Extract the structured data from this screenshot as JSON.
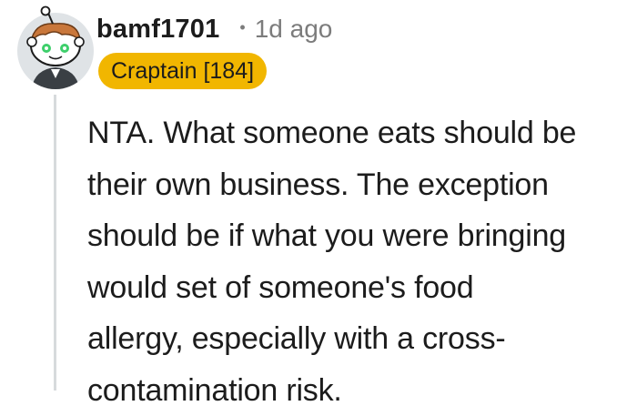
{
  "comment": {
    "username": "bamf1701",
    "separator": "•",
    "time_ago": "1d ago",
    "flair": "Craptain [184]",
    "body_lines": [
      "NTA. What someone eats should be",
      "their own business. The exception",
      "should be if what you were bringing",
      "would set of someone's food",
      "allergy, especially with a cross-",
      "contamination risk."
    ],
    "avatar_icon": "snoo-avatar-icon"
  },
  "colors": {
    "flair_background": "#f1b600",
    "text": "#1c1c1c",
    "meta_text": "#7c7c7c",
    "thread_line": "#d7dadc",
    "avatar_ring": "#dfe3e6"
  }
}
